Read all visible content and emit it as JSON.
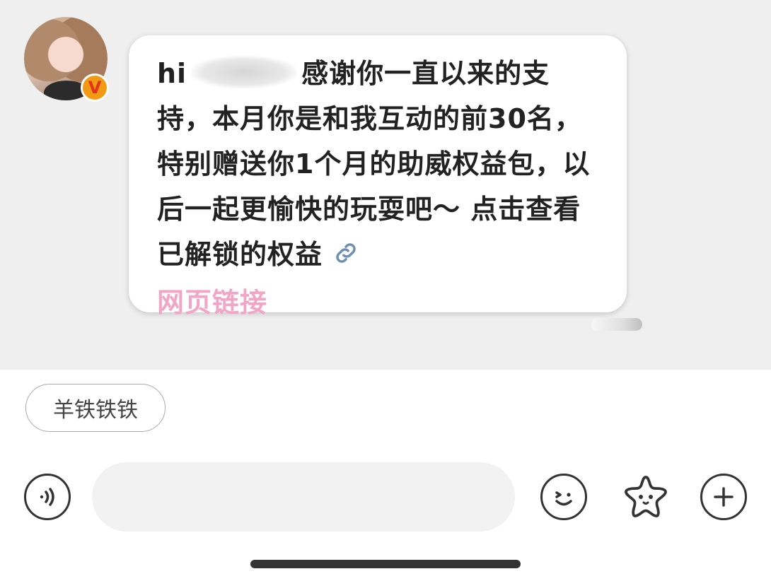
{
  "message": {
    "text_greeting": "hi",
    "text_body": "感谢你一直以来的支持，本月你是和我互动的前30名，特别赠送你1个月的助威权益包，以后一起更愉快的玩耍吧～ 点击查看已解锁的权益",
    "link_label": "网页链接",
    "link_icon": "link-icon"
  },
  "sender": {
    "avatar_icon": "avatar",
    "badge_label": "V",
    "badge_color": "#f39a14"
  },
  "quick_reply": {
    "label": "羊铁铁铁"
  },
  "input_bar": {
    "placeholder": "",
    "voice_icon": "voice-icon",
    "emoji_icon": "emoji-icon",
    "sticker_icon": "star-sticker-icon",
    "plus_icon": "plus-icon"
  },
  "colors": {
    "chat_background": "#efefef",
    "link_color": "#f1a6c7",
    "text_color": "#222222"
  }
}
